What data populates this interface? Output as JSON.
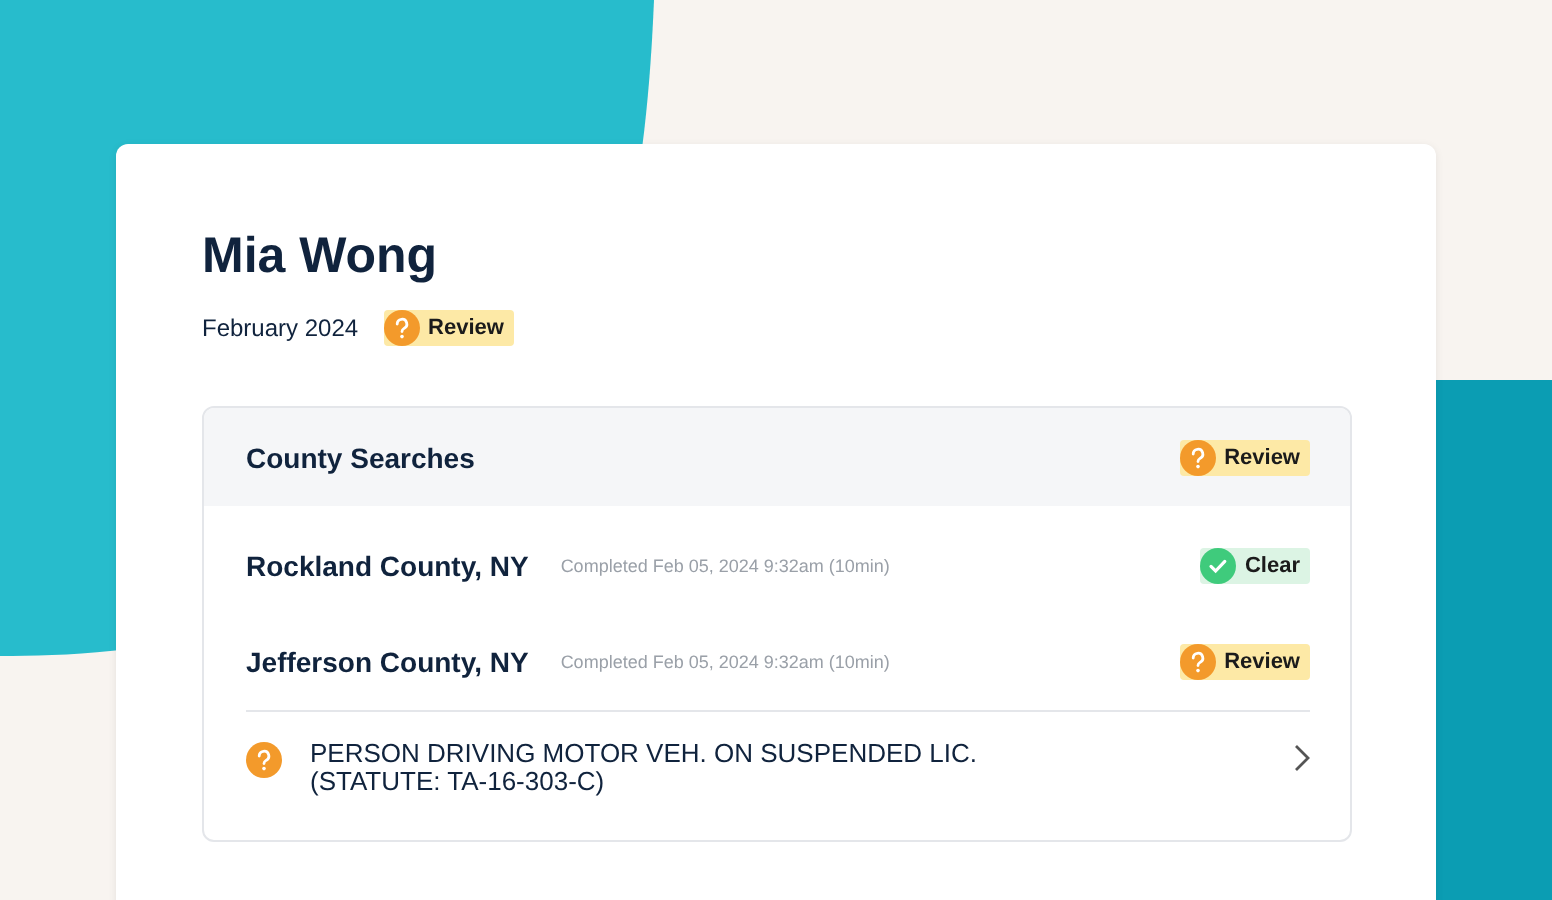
{
  "candidate": {
    "name": "Mia Wong",
    "period": "February 2024",
    "status": {
      "kind": "review",
      "label": "Review"
    }
  },
  "section": {
    "title": "County Searches",
    "status": {
      "kind": "review",
      "label": "Review"
    },
    "rows": [
      {
        "county": "Rockland County, NY",
        "completed": "Completed Feb 05, 2024 9:32am (10min)",
        "status": {
          "kind": "clear",
          "label": "Clear"
        }
      },
      {
        "county": "Jefferson County, NY",
        "completed": "Completed Feb 05, 2024 9:32am (10min)",
        "status": {
          "kind": "review",
          "label": "Review"
        }
      }
    ],
    "charges": [
      {
        "kind": "review",
        "lines": [
          "PERSON DRIVING MOTOR VEH. ON SUSPENDED LIC.",
          "(STATUTE: TA-16-303-C)"
        ]
      }
    ]
  }
}
